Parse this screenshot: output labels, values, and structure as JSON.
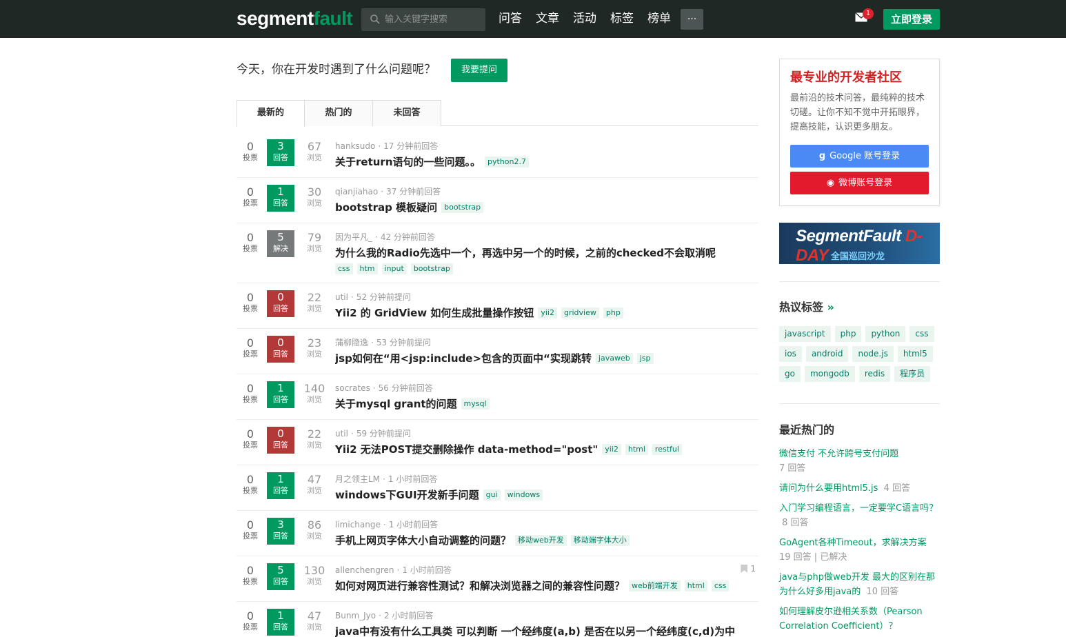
{
  "header": {
    "logo_a": "segment",
    "logo_b": "fault",
    "search_placeholder": "输入关键字搜索",
    "nav": [
      "问答",
      "文章",
      "活动",
      "标签",
      "榜单"
    ],
    "more": "···",
    "mail_badge": "1",
    "login": "立即登录"
  },
  "ask": {
    "text": "今天，你在开发时遇到了什么问题呢？",
    "button": "我要提问"
  },
  "tabs": [
    "最新的",
    "热门的",
    "未回答"
  ],
  "questions": [
    {
      "votes": "0",
      "votes_label": "投票",
      "answers": "3",
      "answers_label": "回答",
      "state": "answered",
      "views": "67",
      "views_label": "浏览",
      "user": "hanksudo",
      "time": "17 分钟前回答",
      "title": "关于return语句的一些问题。。",
      "tags": [
        "python2.7"
      ]
    },
    {
      "votes": "0",
      "votes_label": "投票",
      "answers": "1",
      "answers_label": "回答",
      "state": "answered",
      "views": "30",
      "views_label": "浏览",
      "user": "qianjiahao",
      "time": "37 分钟前回答",
      "title": "bootstrap 模板疑问",
      "tags": [
        "bootstrap"
      ]
    },
    {
      "votes": "0",
      "votes_label": "投票",
      "answers": "5",
      "answers_label": "解决",
      "state": "solved",
      "views": "79",
      "views_label": "浏览",
      "user": "因为平凡_",
      "time": "42 分钟前回答",
      "title": "为什么我的Radio先选中一个，再选中另一个的时候，之前的checked不会取消呢",
      "tags": [
        "css",
        "htm",
        "input",
        "bootstrap"
      ]
    },
    {
      "votes": "0",
      "votes_label": "投票",
      "answers": "0",
      "answers_label": "回答",
      "state": "unanswered",
      "views": "22",
      "views_label": "浏览",
      "user": "util",
      "time": "52 分钟前提问",
      "title": "Yii2 的 GridView 如何生成批量操作按钮",
      "tags": [
        "yii2",
        "gridview",
        "php"
      ]
    },
    {
      "votes": "0",
      "votes_label": "投票",
      "answers": "0",
      "answers_label": "回答",
      "state": "unanswered",
      "views": "23",
      "views_label": "浏览",
      "user": "蒲柳隐逸",
      "time": "53 分钟前提问",
      "title": "jsp如何在“用<jsp:include>包含的页面中“实现跳转",
      "tags": [
        "javaweb",
        "jsp"
      ]
    },
    {
      "votes": "0",
      "votes_label": "投票",
      "answers": "1",
      "answers_label": "回答",
      "state": "answered",
      "views": "140",
      "views_label": "浏览",
      "user": "socrates",
      "time": "56 分钟前回答",
      "title": "关于mysql grant的问题",
      "tags": [
        "mysql"
      ]
    },
    {
      "votes": "0",
      "votes_label": "投票",
      "answers": "0",
      "answers_label": "回答",
      "state": "unanswered",
      "views": "22",
      "views_label": "浏览",
      "user": "util",
      "time": "59 分钟前提问",
      "title": "Yii2 无法POST提交删除操作 data-method=\"post\"",
      "tags": [
        "yii2",
        "html",
        "restful"
      ]
    },
    {
      "votes": "0",
      "votes_label": "投票",
      "answers": "1",
      "answers_label": "回答",
      "state": "answered",
      "views": "47",
      "views_label": "浏览",
      "user": "月之领主LM",
      "time": "1 小时前回答",
      "title": "windows下GUI开发新手问题",
      "tags": [
        "gui",
        "windows"
      ]
    },
    {
      "votes": "0",
      "votes_label": "投票",
      "answers": "3",
      "answers_label": "回答",
      "state": "answered",
      "views": "86",
      "views_label": "浏览",
      "user": "limichange",
      "time": "1 小时前回答",
      "title": "手机上网页字体大小自动调整的问题？",
      "tags": [
        "移动web开发",
        "移动端字体大小"
      ]
    },
    {
      "votes": "0",
      "votes_label": "投票",
      "answers": "5",
      "answers_label": "回答",
      "state": "answered",
      "views": "130",
      "views_label": "浏览",
      "user": "allenchengren",
      "time": "1 小时前回答",
      "title": "如何对网页进行兼容性测试？和解决浏览器之间的兼容性问题？",
      "tags": [
        "web前端开发",
        "html",
        "css"
      ],
      "flag": "1"
    },
    {
      "votes": "0",
      "votes_label": "投票",
      "answers": "1",
      "answers_label": "回答",
      "state": "answered",
      "views": "47",
      "views_label": "浏览",
      "user": "Bunm_Jyo",
      "time": "2 小时前回答",
      "title": "java中有没有什么工具类 可以判断 一个经纬度(a,b) 是否在以另一个经纬度(c,d)为中",
      "tags": []
    }
  ],
  "sidebar": {
    "promo_title": "最专业的开发者社区",
    "promo_text": "最前沿的技术问答，最纯粹的技术切磋。让你不知不觉中开拓眼界，提高技能，认识更多朋友。",
    "google_login": "Google 账号登录",
    "weibo_login": "微博账号登录",
    "banner_title_a": "SegmentFault ",
    "banner_title_b": "D-DAY",
    "banner_sub": "全国巡回沙龙",
    "hot_tags_title": "热议标签",
    "hot_tags_arrow": "»",
    "hot_tags": [
      [
        "javascript",
        "php",
        "python",
        "css"
      ],
      [
        "ios",
        "android",
        "node.js",
        "html5"
      ],
      [
        "go",
        "mongodb",
        "redis",
        "程序员"
      ]
    ],
    "recent_title": "最近热门的",
    "recent": [
      {
        "title": "微信支付 不允许跨号支付问题",
        "count": "7 回答"
      },
      {
        "title": "请问为什么要用html5.js",
        "count": "4 回答"
      },
      {
        "title": "入门学习编程语言，一定要学C语言吗？",
        "count": "8 回答"
      },
      {
        "title": "GoAgent各种Timeout，求解决方案",
        "count": "19 回答 | 已解决"
      },
      {
        "title": "java与php做web开发 最大的区别在那 为什么好多用java的",
        "count": "10 回答"
      },
      {
        "title": "如何理解皮尔逊相关系数（Pearson Correlation Coefficient）？",
        "count": ""
      }
    ]
  }
}
